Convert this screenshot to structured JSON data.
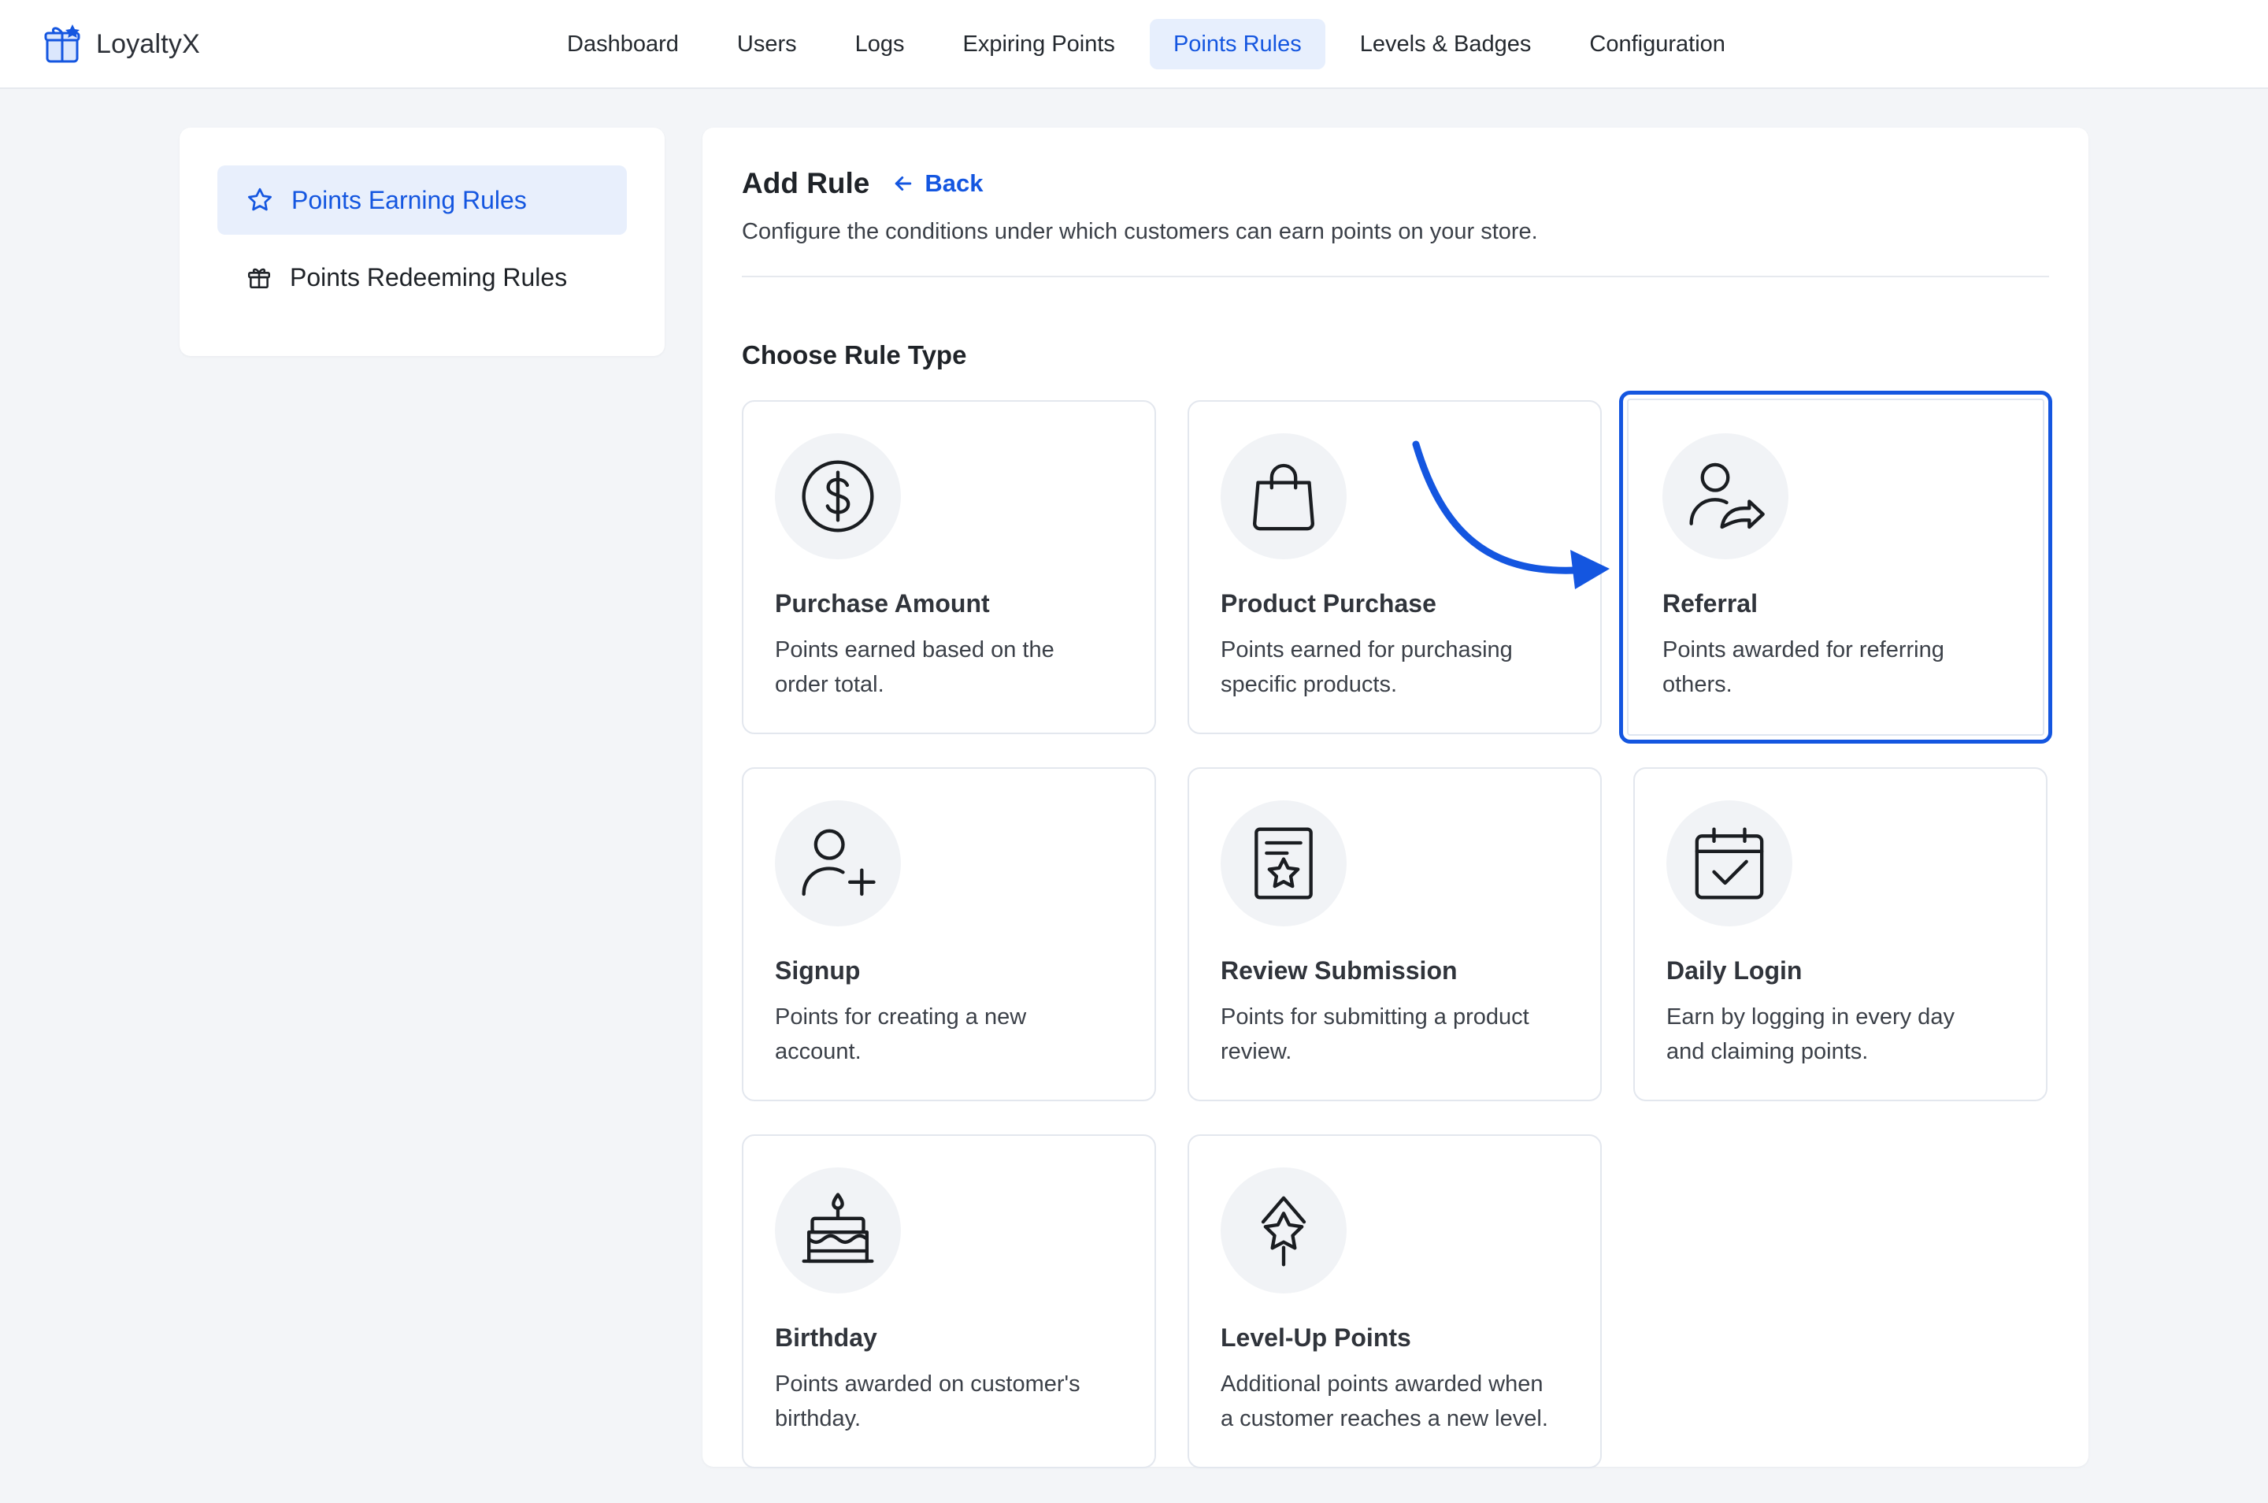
{
  "app": {
    "name": "LoyaltyX",
    "accent_color": "#1456e0"
  },
  "nav": {
    "items": [
      {
        "label": "Dashboard",
        "active": false
      },
      {
        "label": "Users",
        "active": false
      },
      {
        "label": "Logs",
        "active": false
      },
      {
        "label": "Expiring Points",
        "active": false
      },
      {
        "label": "Points Rules",
        "active": true
      },
      {
        "label": "Levels & Badges",
        "active": false
      },
      {
        "label": "Configuration",
        "active": false
      }
    ]
  },
  "sidebar": {
    "items": [
      {
        "label": "Points Earning Rules",
        "icon": "star-icon",
        "active": true
      },
      {
        "label": "Points Redeeming Rules",
        "icon": "gift-icon",
        "active": false
      }
    ]
  },
  "main": {
    "title": "Add Rule",
    "back_label": "Back",
    "subtitle": "Configure the conditions under which customers can earn points on your store.",
    "section_title": "Choose Rule Type",
    "selected_rule": "Referral",
    "rule_types": [
      {
        "title": "Purchase Amount",
        "description": "Points earned based on the order total.",
        "icon": "dollar-circle-icon"
      },
      {
        "title": "Product Purchase",
        "description": "Points earned for purchasing specific products.",
        "icon": "shopping-bag-icon"
      },
      {
        "title": "Referral",
        "description": "Points awarded for referring others.",
        "icon": "user-share-icon"
      },
      {
        "title": "Signup",
        "description": "Points for creating a new account.",
        "icon": "user-plus-icon"
      },
      {
        "title": "Review Submission",
        "description": "Points for submitting a product review.",
        "icon": "review-star-icon"
      },
      {
        "title": "Daily Login",
        "description": "Earn by logging in every day and claiming points.",
        "icon": "calendar-check-icon"
      },
      {
        "title": "Birthday",
        "description": "Points awarded on customer's birthday.",
        "icon": "birthday-cake-icon"
      },
      {
        "title": "Level-Up Points",
        "description": "Additional points awarded when a customer reaches a new level.",
        "icon": "level-up-star-icon"
      }
    ]
  }
}
